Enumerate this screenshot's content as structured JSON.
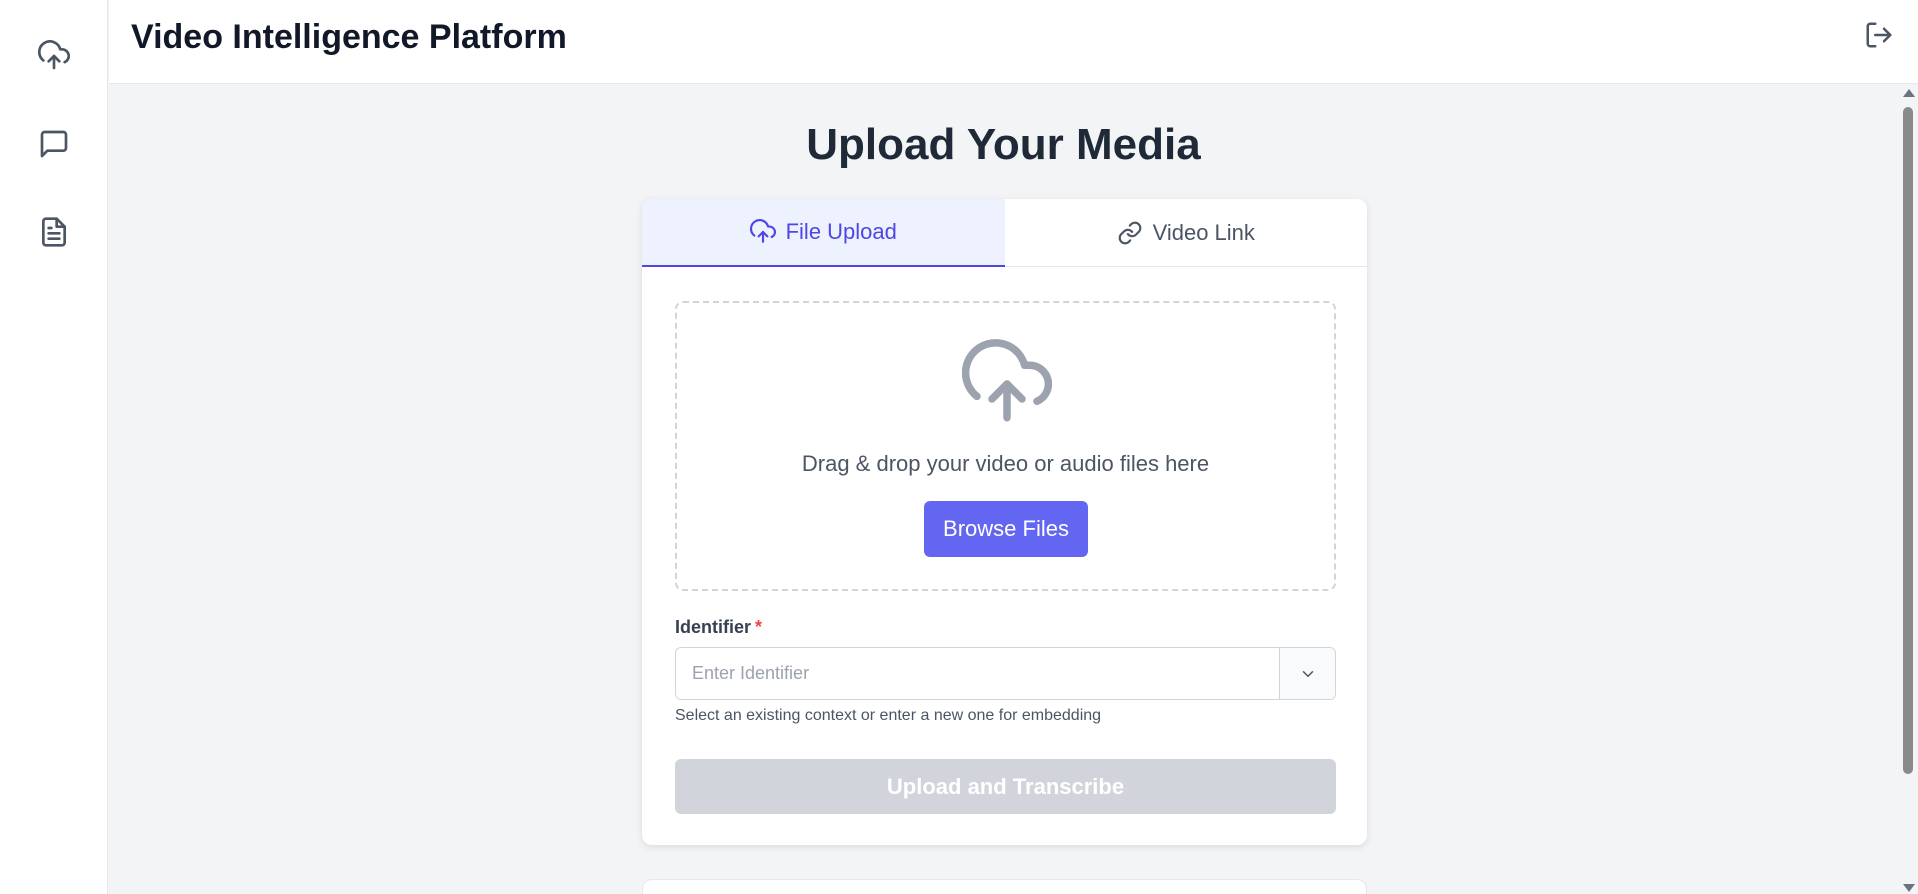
{
  "colors": {
    "accent": "#6366f1",
    "accent_text": "#4f46e5",
    "active_tab_bg": "#eef2ff",
    "disabled": "#d1d5db",
    "required": "#ef4444",
    "page_bg": "#f3f4f6"
  },
  "sidebar": {
    "items": [
      {
        "icon": "cloud-upload-icon"
      },
      {
        "icon": "chat-icon"
      },
      {
        "icon": "document-icon"
      }
    ]
  },
  "header": {
    "title": "Video Intelligence Platform",
    "logout_icon": "logout-icon"
  },
  "main": {
    "page_title": "Upload Your Media",
    "tabs": [
      {
        "label": "File Upload",
        "icon": "cloud-upload-icon",
        "active": true
      },
      {
        "label": "Video Link",
        "icon": "link-icon",
        "active": false
      }
    ],
    "dropzone": {
      "icon": "cloud-upload-icon",
      "text": "Drag & drop your video or audio files here",
      "browse_label": "Browse Files"
    },
    "identifier": {
      "label": "Identifier",
      "required_mark": "*",
      "placeholder": "Enter Identifier",
      "value": "",
      "dropdown_icon": "chevron-down-icon",
      "help": "Select an existing context or enter a new one for embedding"
    },
    "submit_label": "Upload and Transcribe"
  }
}
